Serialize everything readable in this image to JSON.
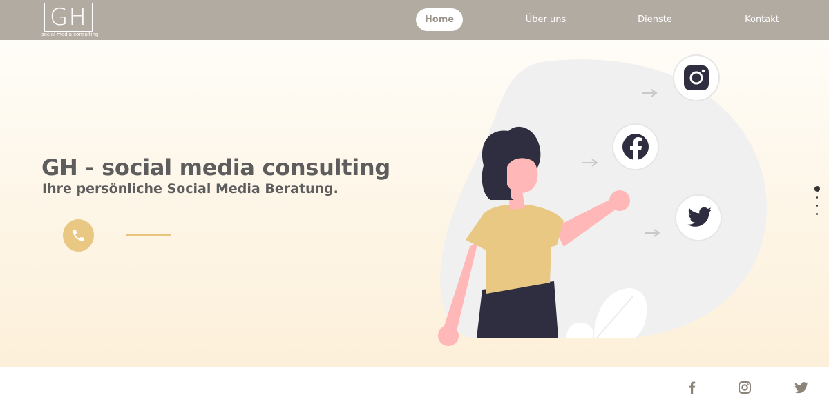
{
  "header": {
    "logo": {
      "letters": "GH",
      "tagline": "social media consulting"
    },
    "nav": [
      {
        "label": "Home",
        "active": true
      },
      {
        "label": "Über uns",
        "active": false
      },
      {
        "label": "Dienste",
        "active": false
      },
      {
        "label": "Kontakt",
        "active": false
      }
    ]
  },
  "hero": {
    "title": "GH - social media consulting",
    "subtitle": "Ihre persönliche Social Media Beratung.",
    "call_icon": "phone-icon",
    "illustration_icons": [
      "instagram-icon",
      "facebook-icon",
      "twitter-icon"
    ],
    "slides": {
      "count": 4,
      "active": 1
    }
  },
  "footer": {
    "social": [
      "facebook-icon",
      "instagram-icon",
      "twitter-icon"
    ]
  },
  "colors": {
    "header_bg": "#b2aba2",
    "accent": "#e8c883",
    "text": "#5d5d5d",
    "illustration_dark": "#2f2e41",
    "skin": "#ffb7b7",
    "footer_icon": "#8c8479"
  }
}
